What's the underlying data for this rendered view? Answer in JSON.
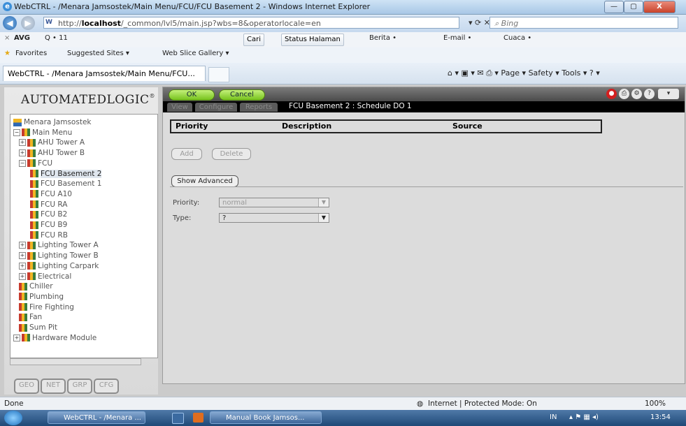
{
  "window": {
    "title": "WebCTRL - /Menara Jamsostek/Main Menu/FCU/FCU Basement 2 - Windows Internet Explorer",
    "min": "—",
    "max": "▢",
    "close": "X"
  },
  "address": {
    "url_prefix": "http://",
    "url_host": "localhost",
    "url_rest": "/_common/lvl5/main.jsp?wbs=8&operatorlocale=en",
    "search_placeholder": "Bing"
  },
  "toolbar_avg": {
    "brand": "AVG",
    "search": "Q • 11",
    "cari": "Cari",
    "status": "Status Halaman",
    "berita": "Berita •",
    "email": "E-mail •",
    "cuaca": "Cuaca •"
  },
  "favorites": {
    "label": "Favorites",
    "suggested": "Suggested Sites ▾",
    "webslice": "Web Slice Gallery ▾"
  },
  "tab": {
    "title": "WebCTRL - /Menara Jamsostek/Main Menu/FCU...",
    "commands": "⌂ ▾  ▣ ▾  ✉  ⎙ ▾  Page ▾  Safety ▾  Tools ▾  ? ▾"
  },
  "logo": "AUTOMATEDLOGIC",
  "tree": [
    {
      "label": "Menara Jamsostek",
      "indent": 0,
      "expander": "",
      "icon": "bld"
    },
    {
      "label": "Main Menu",
      "indent": 0,
      "expander": "−",
      "icon": "net"
    },
    {
      "label": "AHU Tower A",
      "indent": 1,
      "expander": "+",
      "icon": "net"
    },
    {
      "label": "AHU Tower B",
      "indent": 1,
      "expander": "+",
      "icon": "net"
    },
    {
      "label": "FCU",
      "indent": 1,
      "expander": "−",
      "icon": "net"
    },
    {
      "label": "FCU Basement 2",
      "indent": 2,
      "expander": "",
      "icon": "net",
      "selected": true
    },
    {
      "label": "FCU Basement 1",
      "indent": 2,
      "expander": "",
      "icon": "net"
    },
    {
      "label": "FCU A10",
      "indent": 2,
      "expander": "",
      "icon": "net"
    },
    {
      "label": "FCU RA",
      "indent": 2,
      "expander": "",
      "icon": "net"
    },
    {
      "label": "FCU B2",
      "indent": 2,
      "expander": "",
      "icon": "net"
    },
    {
      "label": "FCU B9",
      "indent": 2,
      "expander": "",
      "icon": "net"
    },
    {
      "label": "FCU RB",
      "indent": 2,
      "expander": "",
      "icon": "net"
    },
    {
      "label": "Lighting Tower A",
      "indent": 1,
      "expander": "+",
      "icon": "net"
    },
    {
      "label": "Lighting Tower B",
      "indent": 1,
      "expander": "+",
      "icon": "net"
    },
    {
      "label": "Lighting Carpark",
      "indent": 1,
      "expander": "+",
      "icon": "net"
    },
    {
      "label": "Electrical",
      "indent": 1,
      "expander": "+",
      "icon": "net"
    },
    {
      "label": "Chiller",
      "indent": 1,
      "expander": "",
      "icon": "net"
    },
    {
      "label": "Plumbing",
      "indent": 1,
      "expander": "",
      "icon": "net"
    },
    {
      "label": "Fire Fighting",
      "indent": 1,
      "expander": "",
      "icon": "net"
    },
    {
      "label": "Fan",
      "indent": 1,
      "expander": "",
      "icon": "net"
    },
    {
      "label": "Sum Pit",
      "indent": 1,
      "expander": "",
      "icon": "net"
    },
    {
      "label": "Hardware Module",
      "indent": 0,
      "expander": "+",
      "icon": "net"
    }
  ],
  "bottom_tabs": [
    "GEO",
    "NET",
    "GRP",
    "CFG"
  ],
  "content": {
    "ok": "OK",
    "cancel": "Cancel",
    "tabs": [
      "View",
      "Configure",
      "Reports"
    ],
    "crumb": "FCU Basement 2 : Schedule DO 1",
    "columns": [
      "Priority",
      "Description",
      "Source"
    ],
    "add": "Add",
    "delete": "Delete",
    "show_advanced": "Show Advanced",
    "priority_label": "Priority:",
    "priority_value": "normal",
    "type_label": "Type:",
    "type_value": "?"
  },
  "status": {
    "left": "Done",
    "zone": "Internet | Protected Mode: On",
    "zoom": "100%"
  },
  "taskbar": {
    "items": [
      "WebCTRL - /Menara ...",
      "Manual Book Jamsos..."
    ],
    "lang": "IN",
    "clock": "13:54"
  }
}
